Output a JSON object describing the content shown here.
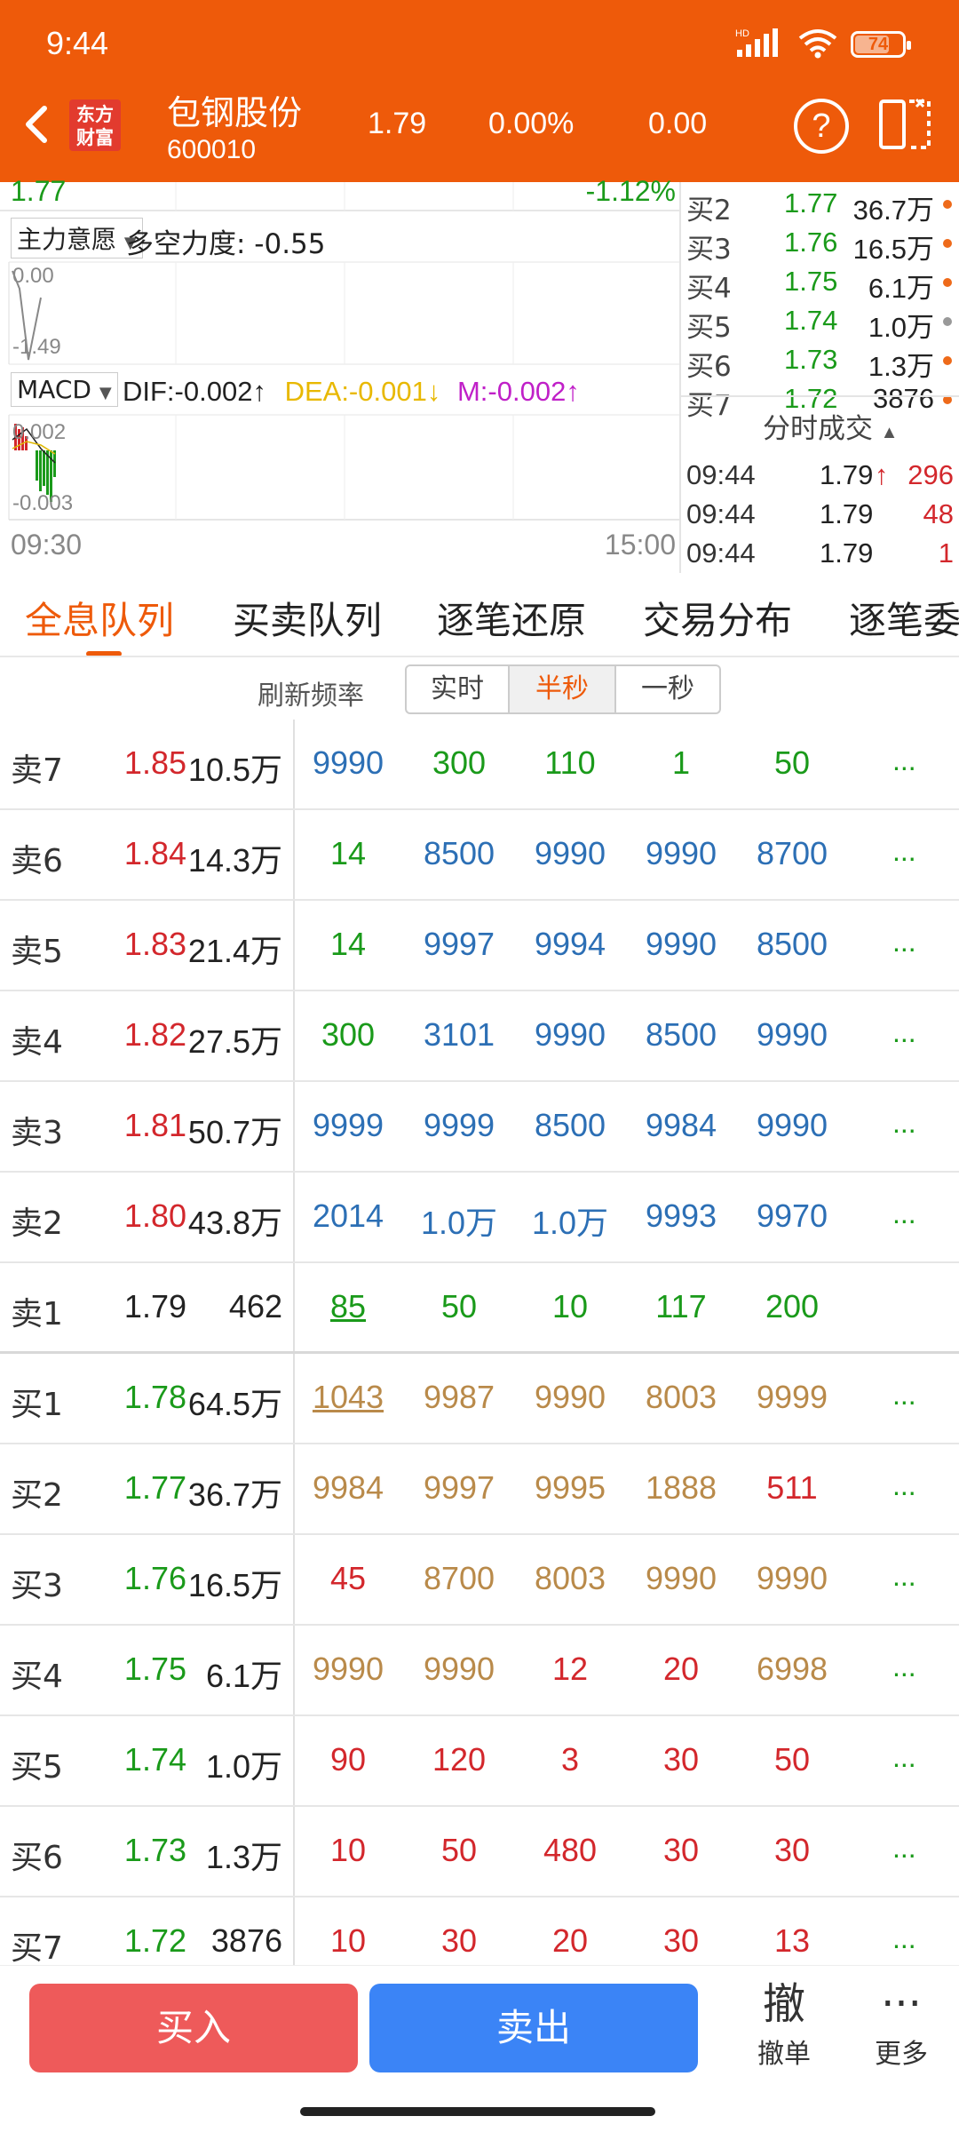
{
  "status_bar": {
    "time": "9:44",
    "network": "HD",
    "battery": "74",
    "battery_fraction": 0.74
  },
  "header": {
    "logo_line1": "东方",
    "logo_line2": "财富",
    "stock_name": "包钢股份",
    "stock_code": "600010",
    "price": "1.79",
    "change_pct": "0.00%",
    "change": "0.00"
  },
  "chart": {
    "top_left_value": "1.77",
    "top_right_value": "-1.12%",
    "indicator1": {
      "name": "主力意愿",
      "text": "多空力度: -0.55",
      "tick_top": "0.00",
      "tick_bottom": "-1.49"
    },
    "indicator2": {
      "name": "MACD",
      "dif": "DIF:-0.002",
      "dif_arrow": "↑",
      "dea": "DEA:-0.001",
      "dea_arrow": "↓",
      "m": "M:-0.002",
      "m_arrow": "↑",
      "tick_top": "0.002",
      "tick_bottom": "-0.003"
    },
    "time_start": "09:30",
    "time_end": "15:00"
  },
  "mini_book": [
    {
      "label": "买2",
      "price": "1.77",
      "vol": "36.7万"
    },
    {
      "label": "买3",
      "price": "1.76",
      "vol": "16.5万"
    },
    {
      "label": "买4",
      "price": "1.75",
      "vol": "6.1万"
    },
    {
      "label": "买5",
      "price": "1.74",
      "vol": "1.0万"
    },
    {
      "label": "买6",
      "price": "1.73",
      "vol": "1.3万"
    },
    {
      "label": "买7",
      "price": "1.72",
      "vol": "3876"
    }
  ],
  "ticks": {
    "title": "分时成交",
    "rows": [
      {
        "time": "09:44",
        "price": "1.79",
        "arrow": "↑",
        "vol": "296"
      },
      {
        "time": "09:44",
        "price": "1.79",
        "arrow": "",
        "vol": "48"
      },
      {
        "time": "09:44",
        "price": "1.79",
        "arrow": "",
        "vol": "1"
      }
    ]
  },
  "tabs": [
    "全息队列",
    "买卖队列",
    "逐笔还原",
    "交易分布",
    "逐笔委"
  ],
  "refresh": {
    "label": "刷新频率",
    "options": [
      "实时",
      "半秒",
      "一秒"
    ],
    "selected": "半秒"
  },
  "colors": {
    "accent": "#ee5a0a",
    "up": "#d3272c",
    "down": "#1a9a1a",
    "blue": "#2c6fb5",
    "gold": "#b98a4a",
    "buy_button": "#ee5a5a",
    "sell_button": "#3b84f6"
  },
  "order_book": [
    {
      "label": "卖7",
      "price": "1.85",
      "vol": "10.5万",
      "price_color": "red",
      "cells": [
        [
          "9990",
          "blue"
        ],
        [
          "300",
          "green"
        ],
        [
          "110",
          "green"
        ],
        [
          "1",
          "green"
        ],
        [
          "50",
          "green"
        ]
      ],
      "more": "..."
    },
    {
      "label": "卖6",
      "price": "1.84",
      "vol": "14.3万",
      "price_color": "red",
      "cells": [
        [
          "14",
          "green"
        ],
        [
          "8500",
          "blue"
        ],
        [
          "9990",
          "blue"
        ],
        [
          "9990",
          "blue"
        ],
        [
          "8700",
          "blue"
        ]
      ],
      "more": "..."
    },
    {
      "label": "卖5",
      "price": "1.83",
      "vol": "21.4万",
      "price_color": "red",
      "cells": [
        [
          "14",
          "green"
        ],
        [
          "9997",
          "blue"
        ],
        [
          "9994",
          "blue"
        ],
        [
          "9990",
          "blue"
        ],
        [
          "8500",
          "blue"
        ]
      ],
      "more": "..."
    },
    {
      "label": "卖4",
      "price": "1.82",
      "vol": "27.5万",
      "price_color": "red",
      "cells": [
        [
          "300",
          "green"
        ],
        [
          "3101",
          "blue"
        ],
        [
          "9990",
          "blue"
        ],
        [
          "8500",
          "blue"
        ],
        [
          "9990",
          "blue"
        ]
      ],
      "more": "..."
    },
    {
      "label": "卖3",
      "price": "1.81",
      "vol": "50.7万",
      "price_color": "red",
      "cells": [
        [
          "9999",
          "blue"
        ],
        [
          "9999",
          "blue"
        ],
        [
          "8500",
          "blue"
        ],
        [
          "9984",
          "blue"
        ],
        [
          "9990",
          "blue"
        ]
      ],
      "more": "..."
    },
    {
      "label": "卖2",
      "price": "1.80",
      "vol": "43.8万",
      "price_color": "red",
      "cells": [
        [
          "2014",
          "blue"
        ],
        [
          "1.0万",
          "blue"
        ],
        [
          "1.0万",
          "blue"
        ],
        [
          "9993",
          "blue"
        ],
        [
          "9970",
          "blue"
        ]
      ],
      "more": "..."
    },
    {
      "label": "卖1",
      "price": "1.79",
      "vol": "462",
      "price_color": "black",
      "cells": [
        [
          "85",
          "green-ul"
        ],
        [
          "50",
          "green"
        ],
        [
          "10",
          "green"
        ],
        [
          "117",
          "green"
        ],
        [
          "200",
          "green"
        ]
      ],
      "more": ""
    },
    {
      "label": "买1",
      "price": "1.78",
      "vol": "64.5万",
      "price_color": "green",
      "cells": [
        [
          "1043",
          "gold-ul"
        ],
        [
          "9987",
          "gold"
        ],
        [
          "9990",
          "gold"
        ],
        [
          "8003",
          "gold"
        ],
        [
          "9999",
          "gold"
        ]
      ],
      "more": "..."
    },
    {
      "label": "买2",
      "price": "1.77",
      "vol": "36.7万",
      "price_color": "green",
      "cells": [
        [
          "9984",
          "gold"
        ],
        [
          "9997",
          "gold"
        ],
        [
          "9995",
          "gold"
        ],
        [
          "1888",
          "gold"
        ],
        [
          "511",
          "red"
        ]
      ],
      "more": "..."
    },
    {
      "label": "买3",
      "price": "1.76",
      "vol": "16.5万",
      "price_color": "green",
      "cells": [
        [
          "45",
          "red"
        ],
        [
          "8700",
          "gold"
        ],
        [
          "8003",
          "gold"
        ],
        [
          "9990",
          "gold"
        ],
        [
          "9990",
          "gold"
        ]
      ],
      "more": "..."
    },
    {
      "label": "买4",
      "price": "1.75",
      "vol": "6.1万",
      "price_color": "green",
      "cells": [
        [
          "9990",
          "gold"
        ],
        [
          "9990",
          "gold"
        ],
        [
          "12",
          "red"
        ],
        [
          "20",
          "red"
        ],
        [
          "6998",
          "gold"
        ]
      ],
      "more": "..."
    },
    {
      "label": "买5",
      "price": "1.74",
      "vol": "1.0万",
      "price_color": "green",
      "cells": [
        [
          "90",
          "red"
        ],
        [
          "120",
          "red"
        ],
        [
          "3",
          "red"
        ],
        [
          "30",
          "red"
        ],
        [
          "50",
          "red"
        ]
      ],
      "more": "..."
    },
    {
      "label": "买6",
      "price": "1.73",
      "vol": "1.3万",
      "price_color": "green",
      "cells": [
        [
          "10",
          "red"
        ],
        [
          "50",
          "red"
        ],
        [
          "480",
          "red"
        ],
        [
          "30",
          "red"
        ],
        [
          "30",
          "red"
        ]
      ],
      "more": "..."
    },
    {
      "label": "买7",
      "price": "1.72",
      "vol": "3876",
      "price_color": "green",
      "cells": [
        [
          "10",
          "red"
        ],
        [
          "30",
          "red"
        ],
        [
          "20",
          "red"
        ],
        [
          "30",
          "red"
        ],
        [
          "13",
          "red"
        ]
      ],
      "more": "..."
    }
  ],
  "bottom_bar": {
    "buy": "买入",
    "sell": "卖出",
    "cancel_icon": "撤",
    "cancel": "撤单",
    "more_icon": "···",
    "more": "更多"
  }
}
